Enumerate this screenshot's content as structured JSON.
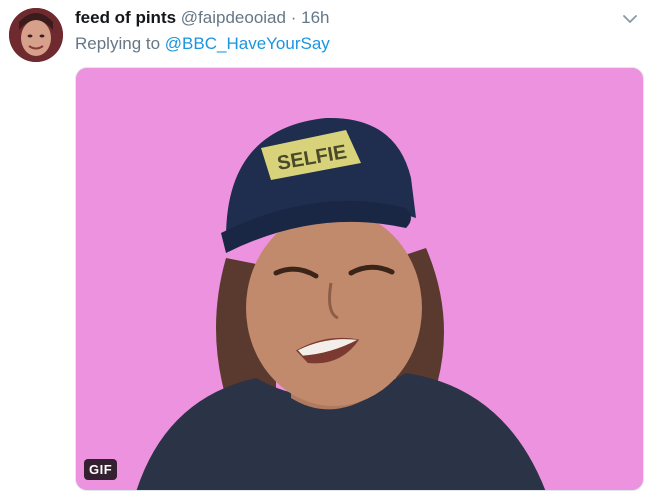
{
  "tweet": {
    "display_name": "feed of pints",
    "handle": "@faipdeooiad",
    "separator": "·",
    "time": "16h",
    "replying_prefix": "Replying to",
    "replying_to": "@BBC_HaveYourSay"
  },
  "media": {
    "badge": "GIF",
    "cap_text": "SELFIE",
    "background_color": "#ec92de"
  },
  "icons": {
    "menu": "chevron-down-icon"
  },
  "colors": {
    "name": "#14171a",
    "secondary": "#657786",
    "link": "#1b95e0"
  }
}
